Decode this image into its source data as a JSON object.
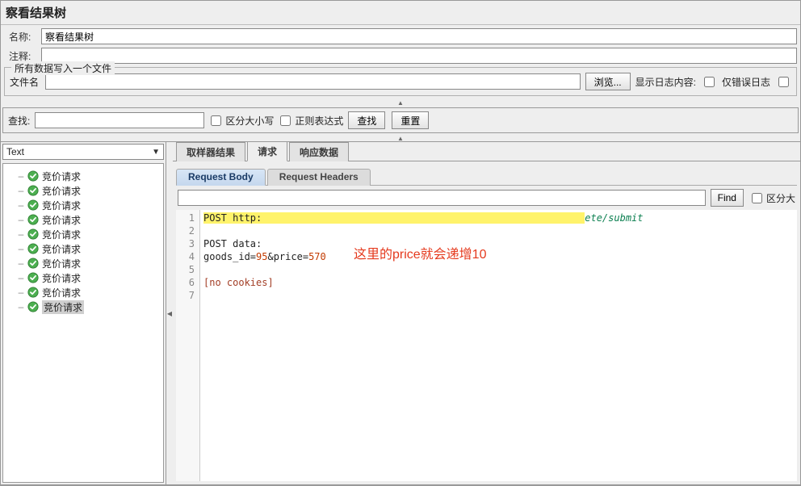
{
  "title": "察看结果树",
  "labels": {
    "name": "名称:",
    "comment": "注释:"
  },
  "form": {
    "name_value": "察看结果树",
    "comment_value": ""
  },
  "file_group": {
    "title": "所有数据写入一个文件",
    "filename_label": "文件名",
    "filename_value": "",
    "browse_button": "浏览...",
    "log_display_label": "显示日志内容:",
    "only_error_label": "仅错误日志"
  },
  "search": {
    "label": "查找:",
    "value": "",
    "case_label": "区分大小写",
    "regex_label": "正则表达式",
    "find_button": "查找",
    "reset_button": "重置"
  },
  "left": {
    "display_select": "Text",
    "items": [
      "竞价请求",
      "竞价请求",
      "竞价请求",
      "竞价请求",
      "竞价请求",
      "竞价请求",
      "竞价请求",
      "竞价请求",
      "竞价请求",
      "竞价请求"
    ],
    "selected_index": 9
  },
  "tabs": {
    "sampler": "取样器结果",
    "request": "请求",
    "response": "响应数据",
    "active": "request"
  },
  "subtabs": {
    "body": "Request Body",
    "headers": "Request Headers",
    "active": "body"
  },
  "find_inner": {
    "value": "",
    "button": "Find",
    "case_label": "区分大"
  },
  "code": {
    "lines": {
      "l1_prefix": "POST http:",
      "l1_suffix": "ete/submit",
      "l2": "",
      "l3": "POST data:",
      "l4_key1": "goods_id=",
      "l4_val1": "95",
      "l4_amp": "&price=",
      "l4_val2": "570",
      "l5": "",
      "l6": "[no cookies]",
      "l7": ""
    }
  },
  "annotation": "这里的price就会递增10"
}
